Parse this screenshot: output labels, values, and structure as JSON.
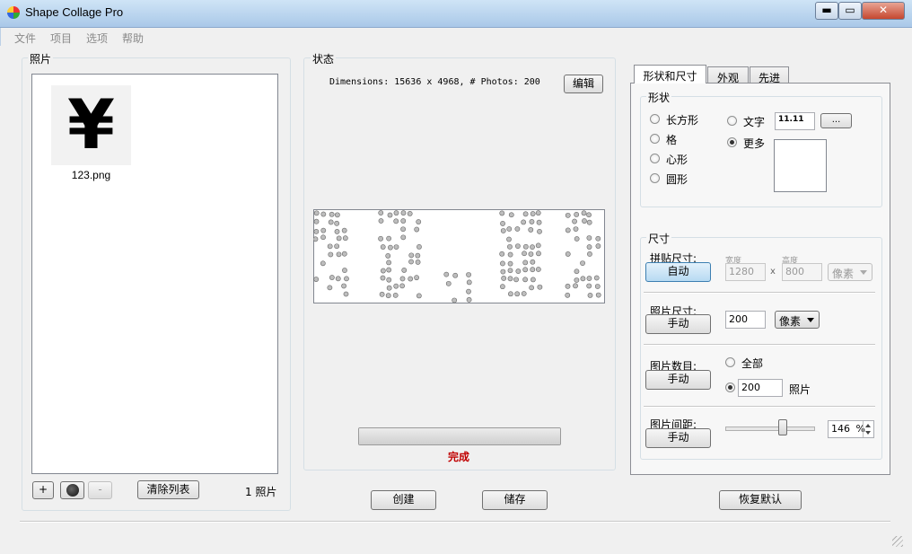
{
  "window": {
    "title": "Shape Collage Pro",
    "min": "▬",
    "max": "▭",
    "close": "✕"
  },
  "menu": [
    "文件",
    "项目",
    "选项",
    "帮助"
  ],
  "photos": {
    "title": "照片",
    "items": [
      {
        "name": "123.png",
        "glyph": "¥"
      }
    ],
    "buttons": {
      "add": "+",
      "remove": "-",
      "clear": "清除列表"
    },
    "count": "1 照片"
  },
  "status": {
    "title": "状态",
    "dimensions": "Dimensions: 15636 x 4968, # Photos: 200",
    "edit": "编辑",
    "progress": 1.0,
    "progress_text": "完成"
  },
  "tabs": [
    "形状和尺寸",
    "外观",
    "先进"
  ],
  "shape": {
    "title": "形状",
    "options": [
      "长方形",
      "格",
      "心形",
      "圆形"
    ],
    "text_option": "文字",
    "text_value": "11.11",
    "ellipsis": "...",
    "more": "更多",
    "selected": "更多"
  },
  "size": {
    "title": "尺寸",
    "collage_label": "拼贴尺寸:",
    "collage_mode": "自动",
    "width_label": "宽度",
    "height_label": "高度",
    "width": "1280",
    "x": "x",
    "height": "800",
    "collage_unit": "像素",
    "photo_label": "照片尺寸:",
    "photo_mode": "手动",
    "photo_size": "200",
    "photo_unit": "像素",
    "count_label": "图片数目:",
    "count_mode": "手动",
    "all": "全部",
    "count_value": "200",
    "count_unit": "照片",
    "spacing_label": "图片间距:",
    "spacing_mode": "手动",
    "spacing_value": "146",
    "spacing_unit": "%",
    "spacing_level": 0.65
  },
  "bottom": {
    "create": "创建",
    "save": "储存",
    "reset": "恢复默认"
  },
  "colors": {
    "progress_text": "#c00000",
    "accent": "#3c7fb1"
  }
}
